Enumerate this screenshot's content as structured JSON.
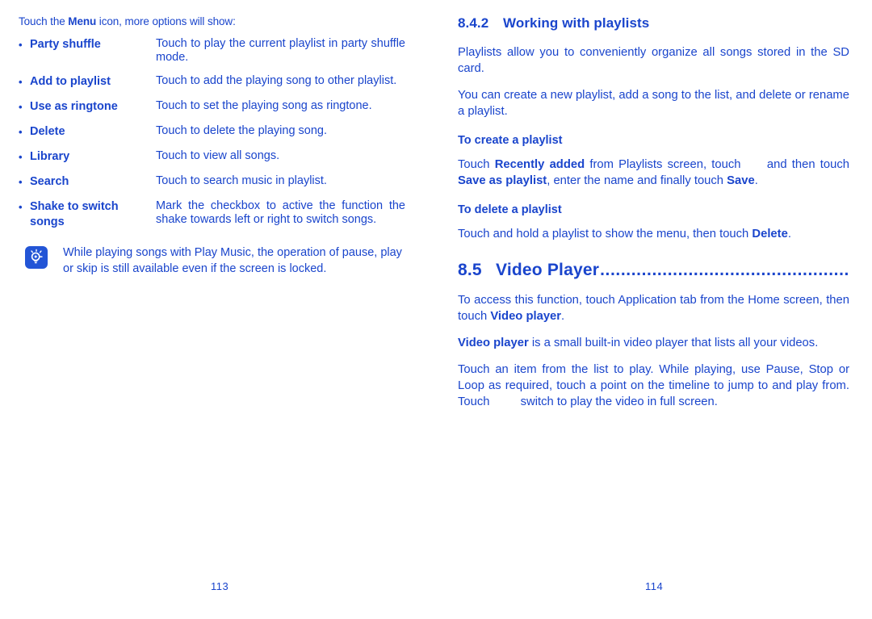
{
  "theme": {
    "text_color": "#1a45cc",
    "icon_bg": "#2355d6"
  },
  "left_page": {
    "number": "113",
    "intro": {
      "before": "Touch the ",
      "bold": "Menu",
      "after": " icon, more options will show:"
    },
    "options": [
      {
        "bullet": "•",
        "term": "Party shuffle",
        "desc": "Touch to play the current playlist in party shuffle mode.",
        "justify": true
      },
      {
        "bullet": "•",
        "term": "Add to playlist",
        "desc": "Touch to add the playing song to other playlist.",
        "justify": false
      },
      {
        "bullet": "•",
        "term": "Use as ringtone",
        "desc": "Touch to set the playing song as ringtone.",
        "justify": false
      },
      {
        "bullet": "•",
        "term": "Delete",
        "desc": "Touch to delete the playing song.",
        "justify": false
      },
      {
        "bullet": "•",
        "term": "Library",
        "desc": "Touch to view all songs.",
        "justify": false
      },
      {
        "bullet": "•",
        "term": "Search",
        "desc": "Touch to search music in playlist.",
        "justify": false
      },
      {
        "bullet": "•",
        "term": "Shake to switch songs",
        "desc": "Mark the checkbox to active the function the shake towards left or right to switch songs.",
        "justify": true
      }
    ],
    "tip": {
      "icon_name": "lightbulb-tip-icon",
      "text": "While playing songs with Play Music, the operation of pause, play or skip is still available even if the screen is locked."
    }
  },
  "right_page": {
    "number": "114",
    "heading_842": {
      "number": "8.4.2",
      "title": "Working with playlists"
    },
    "paragraph_1": "Playlists allow you to conveniently organize all songs stored in the SD card.",
    "paragraph_2": "You can create a new playlist, add a song to the list, and delete or rename a playlist.",
    "subheading_create": "To create a playlist",
    "create_steps": {
      "p1": "Touch ",
      "b1": "Recently added",
      "p2": " from Playlists screen, touch ",
      "p3": " and then touch ",
      "b2": "Save as playlist",
      "p4": ", enter the name and finally touch ",
      "b3": "Save",
      "p5": "."
    },
    "subheading_delete": "To delete a playlist",
    "delete_steps": {
      "p1": "Touch and hold a playlist to show the menu, then touch ",
      "b1": "Delete",
      "p2": "."
    },
    "heading_85": {
      "number": "8.5",
      "title": "Video Player",
      "leaders": "................................................"
    },
    "video_p1": {
      "p1": "To access this function, touch Application tab from the Home screen, then touch ",
      "b1": "Video player",
      "p2": "."
    },
    "video_p2": {
      "b1": "Video player",
      "p1": " is a small built-in video player that lists all your videos."
    },
    "video_p3": {
      "p1": "Touch an item from the list to play. While playing, use Pause, Stop or Loop as required, touch a point on the timeline to jump to and play from. Touch ",
      "p2": "switch to play the video in full screen."
    }
  }
}
